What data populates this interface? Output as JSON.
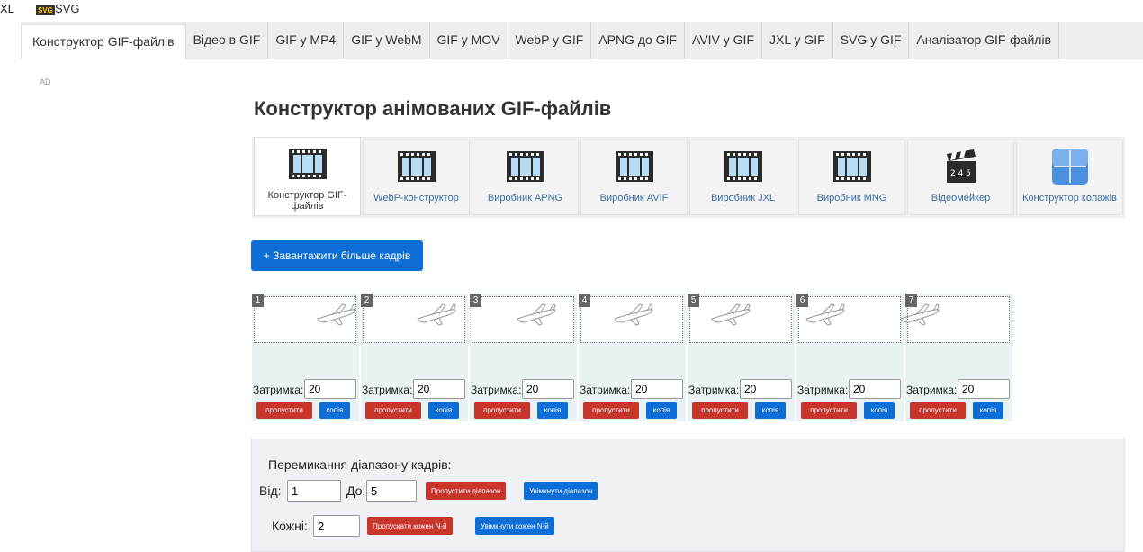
{
  "top_strip": {
    "left_text": "XL",
    "badge": "SVG",
    "right_text": "SVG"
  },
  "tabs": [
    "Конструктор GIF-файлів",
    "Відео в GIF",
    "GIF у MP4",
    "GIF у WebM",
    "GIF у MOV",
    "WebP у GIF",
    "APNG до GIF",
    "AVIV у GIF",
    "JXL у GIF",
    "SVG у GIF",
    "Аналізатор GIF-файлів"
  ],
  "ad_label": "AD",
  "page_title": "Конструктор анімованих GIF-файлів",
  "tools": [
    {
      "label": "Конструктор GIF-файлів",
      "icon": "film-strip-icon"
    },
    {
      "label": "WebP-конструктор",
      "icon": "film-strip-icon"
    },
    {
      "label": "Виробник APNG",
      "icon": "film-strip-icon"
    },
    {
      "label": "Виробник AVIF",
      "icon": "film-strip-icon"
    },
    {
      "label": "Виробник JXL",
      "icon": "film-strip-icon"
    },
    {
      "label": "Виробник MNG",
      "icon": "film-strip-icon"
    },
    {
      "label": "Відеомейкер",
      "icon": "clapperboard-icon"
    },
    {
      "label": "Конструктор колажів",
      "icon": "collage-grid-icon"
    }
  ],
  "upload_button": "+ Завантажити більше кадрів",
  "frames": [
    {
      "num": "1",
      "delay_label": "Затримка:",
      "delay": "20",
      "skip": "пропустити",
      "copy": "копія"
    },
    {
      "num": "2",
      "delay_label": "Затримка:",
      "delay": "20",
      "skip": "пропустити",
      "copy": "копія"
    },
    {
      "num": "3",
      "delay_label": "Затримка:",
      "delay": "20",
      "skip": "пропустити",
      "copy": "копія"
    },
    {
      "num": "4",
      "delay_label": "Затримка:",
      "delay": "20",
      "skip": "пропустити",
      "copy": "копія"
    },
    {
      "num": "5",
      "delay_label": "Затримка:",
      "delay": "20",
      "skip": "пропустити",
      "copy": "копія"
    },
    {
      "num": "6",
      "delay_label": "Затримка:",
      "delay": "20",
      "skip": "пропустити",
      "copy": "копія"
    },
    {
      "num": "7",
      "delay_label": "Затримка:",
      "delay": "20",
      "skip": "пропустити",
      "copy": "копія"
    }
  ],
  "range_panel": {
    "title": "Перемикання діапазону кадрів:",
    "from_label": "Від:",
    "from_value": "1",
    "to_label": "До:",
    "to_value": "5",
    "skip_range": "Пропустити діапазон",
    "enable_range": "Увімкнути діапазон",
    "every_label": "Кожні:",
    "every_value": "2",
    "skip_nth": "Пропускати кожен N-й",
    "enable_nth": "Увімкнути кожен N-й"
  },
  "colors": {
    "primary": "#0d6ed8",
    "danger": "#c8352b",
    "frame_bg": "#eaf3f3"
  }
}
